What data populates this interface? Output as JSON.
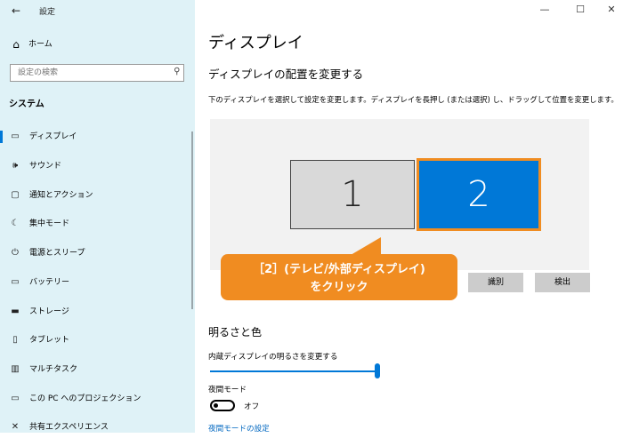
{
  "window": {
    "title": "設定",
    "minimize_glyph": "—",
    "maximize_glyph": "☐",
    "close_glyph": "✕",
    "back_glyph": "←"
  },
  "sidebar": {
    "home": {
      "label": "ホーム",
      "icon": "home-icon"
    },
    "search": {
      "placeholder": "設定の検索",
      "icon": "search-icon"
    },
    "section": "システム",
    "items": [
      {
        "label": "ディスプレイ",
        "icon": "monitor-icon",
        "active": true
      },
      {
        "label": "サウンド",
        "icon": "speaker-icon"
      },
      {
        "label": "通知とアクション",
        "icon": "notification-icon"
      },
      {
        "label": "集中モード",
        "icon": "moon-icon"
      },
      {
        "label": "電源とスリープ",
        "icon": "power-icon"
      },
      {
        "label": "バッテリー",
        "icon": "battery-icon"
      },
      {
        "label": "ストレージ",
        "icon": "storage-icon"
      },
      {
        "label": "タブレット",
        "icon": "tablet-icon"
      },
      {
        "label": "マルチタスク",
        "icon": "multitask-icon"
      },
      {
        "label": "この PC へのプロジェクション",
        "icon": "projection-icon"
      },
      {
        "label": "共有エクスペリエンス",
        "icon": "share-icon"
      }
    ]
  },
  "main": {
    "title": "ディスプレイ",
    "arrange_heading": "ディスプレイの配置を変更する",
    "arrange_desc": "下のディスプレイを選択して設定を変更します。ディスプレイを長押し (または選択) し、ドラッグして位置を変更します。",
    "monitors": [
      "1",
      "2"
    ],
    "identify_label": "識別",
    "detect_label": "検出",
    "callout": {
      "line1": "［2］(テレビ/外部ディスプレイ)",
      "line2": "をクリック"
    },
    "brightness_heading": "明るさと色",
    "brightness_label": "内蔵ディスプレイの明るさを変更する",
    "brightness_value_percent": 100,
    "night_label": "夜間モード",
    "night_state": "オフ",
    "night_link": "夜間モードの設定"
  },
  "colors": {
    "sidebar_bg": "#dff2f7",
    "accent": "#0078d7",
    "callout": "#f08c21"
  }
}
